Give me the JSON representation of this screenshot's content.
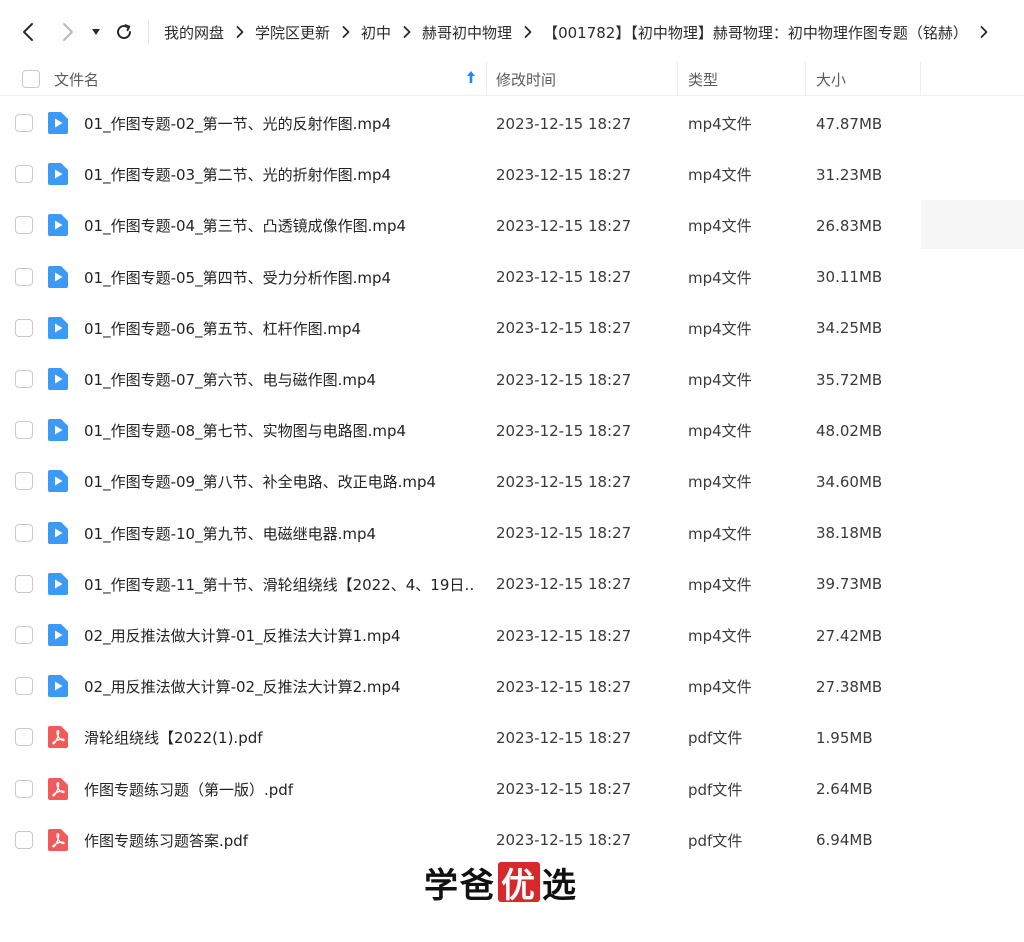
{
  "toolbar": {
    "back_icon": "chevron-left-icon",
    "forward_icon": "chevron-right-icon",
    "dropdown_icon": "caret-down-icon",
    "refresh_icon": "refresh-icon"
  },
  "breadcrumb": {
    "items": [
      "我的网盘",
      "学院区更新",
      "初中",
      "赫哥初中物理",
      "【001782】【初中物理】赫哥物理：初中物理作图专题（铭赫）"
    ],
    "separator_icon": "chevron-right-icon"
  },
  "columns": {
    "name": "文件名",
    "modified": "修改时间",
    "type": "类型",
    "size": "大小",
    "sort_icon": "sort-up-arrow-icon",
    "sort_color": "#1e88f5"
  },
  "colors": {
    "video_icon": "#3b9af5",
    "pdf_icon": "#f05a5a",
    "watermark_red": "#d8282c"
  },
  "files": [
    {
      "name": "01_作图专题-02_第一节、光的反射作图.mp4",
      "modified": "2023-12-15 18:27",
      "type": "mp4文件",
      "size": "47.87MB",
      "icon": "video-file-icon"
    },
    {
      "name": "01_作图专题-03_第二节、光的折射作图.mp4",
      "modified": "2023-12-15 18:27",
      "type": "mp4文件",
      "size": "31.23MB",
      "icon": "video-file-icon"
    },
    {
      "name": "01_作图专题-04_第三节、凸透镜成像作图.mp4",
      "modified": "2023-12-15 18:27",
      "type": "mp4文件",
      "size": "26.83MB",
      "icon": "video-file-icon"
    },
    {
      "name": "01_作图专题-05_第四节、受力分析作图.mp4",
      "modified": "2023-12-15 18:27",
      "type": "mp4文件",
      "size": "30.11MB",
      "icon": "video-file-icon"
    },
    {
      "name": "01_作图专题-06_第五节、杠杆作图.mp4",
      "modified": "2023-12-15 18:27",
      "type": "mp4文件",
      "size": "34.25MB",
      "icon": "video-file-icon"
    },
    {
      "name": "01_作图专题-07_第六节、电与磁作图.mp4",
      "modified": "2023-12-15 18:27",
      "type": "mp4文件",
      "size": "35.72MB",
      "icon": "video-file-icon"
    },
    {
      "name": "01_作图专题-08_第七节、实物图与电路图.mp4",
      "modified": "2023-12-15 18:27",
      "type": "mp4文件",
      "size": "48.02MB",
      "icon": "video-file-icon"
    },
    {
      "name": "01_作图专题-09_第八节、补全电路、改正电路.mp4",
      "modified": "2023-12-15 18:27",
      "type": "mp4文件",
      "size": "34.60MB",
      "icon": "video-file-icon"
    },
    {
      "name": "01_作图专题-10_第九节、电磁继电器.mp4",
      "modified": "2023-12-15 18:27",
      "type": "mp4文件",
      "size": "38.18MB",
      "icon": "video-file-icon"
    },
    {
      "name": "01_作图专题-11_第十节、滑轮组绕线【2022、4、19日…",
      "modified": "2023-12-15 18:27",
      "type": "mp4文件",
      "size": "39.73MB",
      "icon": "video-file-icon"
    },
    {
      "name": "02_用反推法做大计算-01_反推法大计算1.mp4",
      "modified": "2023-12-15 18:27",
      "type": "mp4文件",
      "size": "27.42MB",
      "icon": "video-file-icon"
    },
    {
      "name": "02_用反推法做大计算-02_反推法大计算2.mp4",
      "modified": "2023-12-15 18:27",
      "type": "mp4文件",
      "size": "27.38MB",
      "icon": "video-file-icon"
    },
    {
      "name": "滑轮组绕线【2022(1).pdf",
      "modified": "2023-12-15 18:27",
      "type": "pdf文件",
      "size": "1.95MB",
      "icon": "pdf-file-icon"
    },
    {
      "name": "作图专题练习题（第一版）.pdf",
      "modified": "2023-12-15 18:27",
      "type": "pdf文件",
      "size": "2.64MB",
      "icon": "pdf-file-icon"
    },
    {
      "name": "作图专题练习题答案.pdf",
      "modified": "2023-12-15 18:27",
      "type": "pdf文件",
      "size": "6.94MB",
      "icon": "pdf-file-icon"
    }
  ],
  "watermark": {
    "part1": "学爸",
    "highlight": "优",
    "part2": "选"
  }
}
